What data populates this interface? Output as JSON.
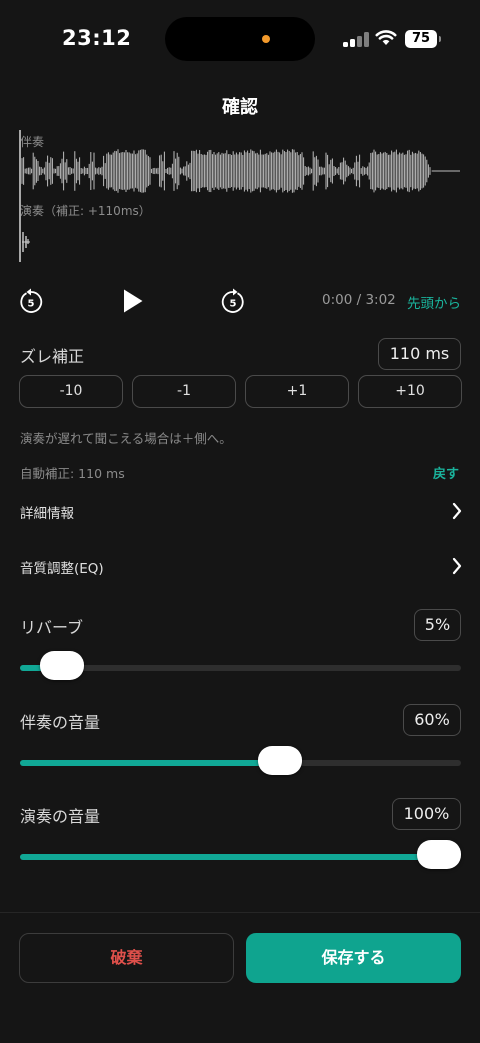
{
  "status_bar": {
    "time": "23:12",
    "battery": "75"
  },
  "header": {
    "title": "確認"
  },
  "waveform": {
    "accompaniment_label": "伴奏",
    "performance_label": "演奏（補正: +110ms）"
  },
  "transport": {
    "rewind_icon": "rewind-5-icon",
    "play_icon": "play-icon",
    "forward_icon": "forward-5-icon",
    "time": "0:00 / 3:02",
    "from_start": "先頭から"
  },
  "offset": {
    "label": "ズレ補正",
    "value": "110 ms",
    "buttons": [
      "-10",
      "-1",
      "+1",
      "+10"
    ],
    "hint": "演奏が遅れて聞こえる場合は＋側へ。",
    "auto": "自動補正: 110 ms",
    "revert": "戻す"
  },
  "menu": {
    "details": "詳細情報",
    "eq": "音質調整(EQ)"
  },
  "sliders": {
    "reverb": {
      "label": "リバーブ",
      "value": "5%",
      "level": 0.05
    },
    "accompaniment": {
      "label": "伴奏の音量",
      "value": "60%",
      "level": 0.6
    },
    "performance": {
      "label": "演奏の音量",
      "value": "100%",
      "level": 1.0
    }
  },
  "actions": {
    "discard": "破棄",
    "save": "保存する"
  },
  "colors": {
    "accent": "#11a896",
    "danger": "#e0504b",
    "background": "#151515"
  }
}
